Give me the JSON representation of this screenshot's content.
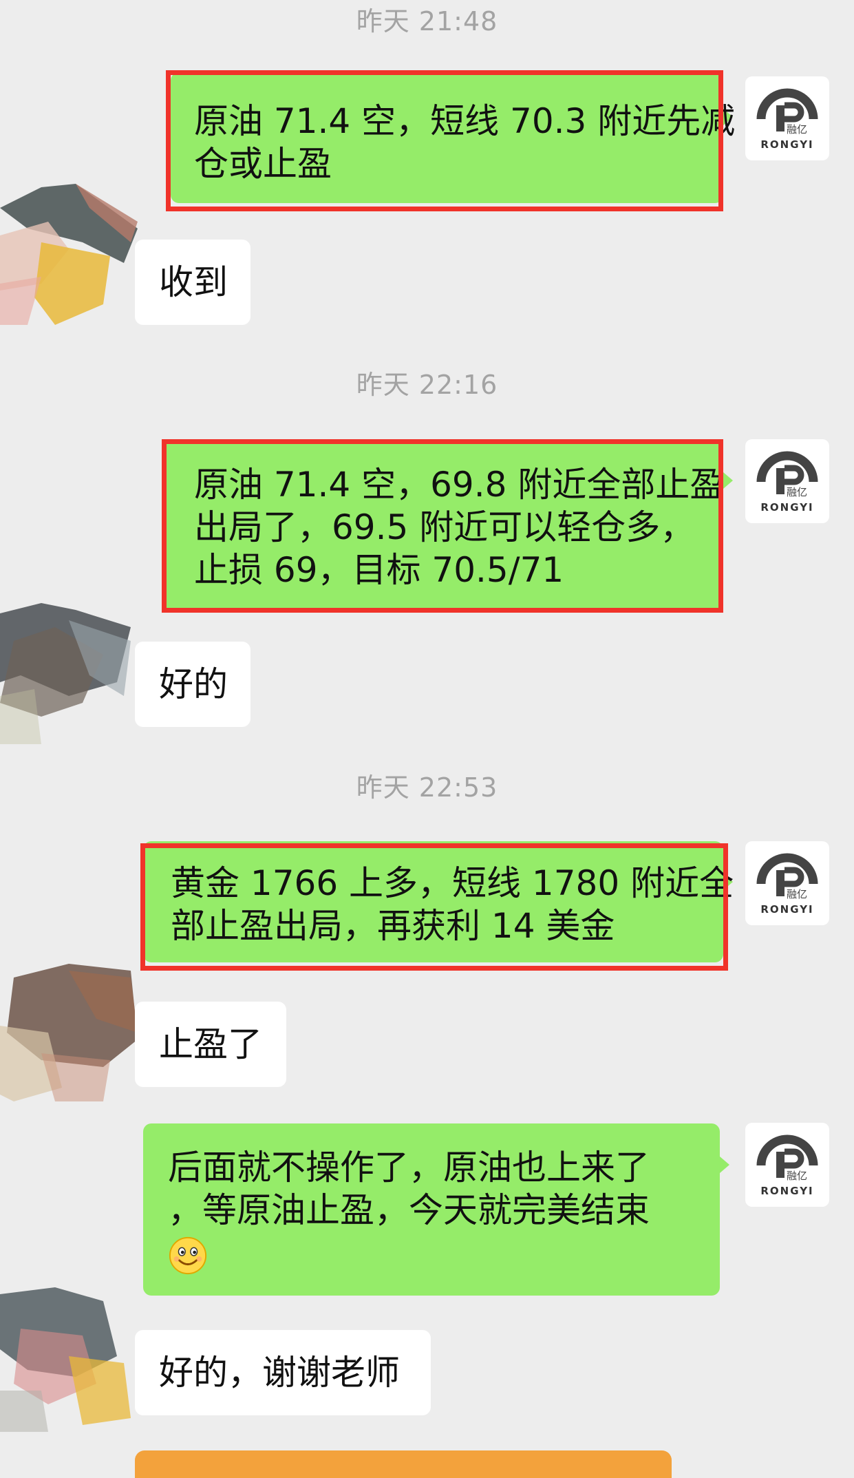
{
  "timestamps": [
    "昨天 21:48",
    "昨天 22:16",
    "昨天 22:53"
  ],
  "avatar_text": {
    "cn": "融亿",
    "en": "RONGYI"
  },
  "messages": [
    {
      "side": "right",
      "lines": [
        "原油 71.4 空，短线 70.3 附近先减",
        "仓或止盈"
      ]
    },
    {
      "side": "left",
      "lines": [
        "收到"
      ]
    },
    {
      "side": "right",
      "lines": [
        "原油 71.4 空，69.8 附近全部止盈",
        "出局了，69.5 附近可以轻仓多，",
        "止损 69，目标 70.5/71"
      ]
    },
    {
      "side": "left",
      "lines": [
        "好的"
      ]
    },
    {
      "side": "right",
      "lines": [
        "黄金 1766 上多，短线 1780 附近全",
        "部止盈出局，再获利 14 美金"
      ]
    },
    {
      "side": "left",
      "lines": [
        "止盈了"
      ]
    },
    {
      "side": "right",
      "lines": [
        "后面就不操作了，原油也上来了",
        "，等原油止盈，今天就完美结束"
      ],
      "emoji": "smile-emoji-icon"
    },
    {
      "side": "left",
      "lines": [
        "好的，谢谢老师"
      ]
    }
  ],
  "colors": {
    "background": "#ededed",
    "bubble_green": "#95ec69",
    "bubble_white": "#ffffff",
    "highlight_outline": "#f0332a",
    "timestamp": "#a3a3a3"
  }
}
